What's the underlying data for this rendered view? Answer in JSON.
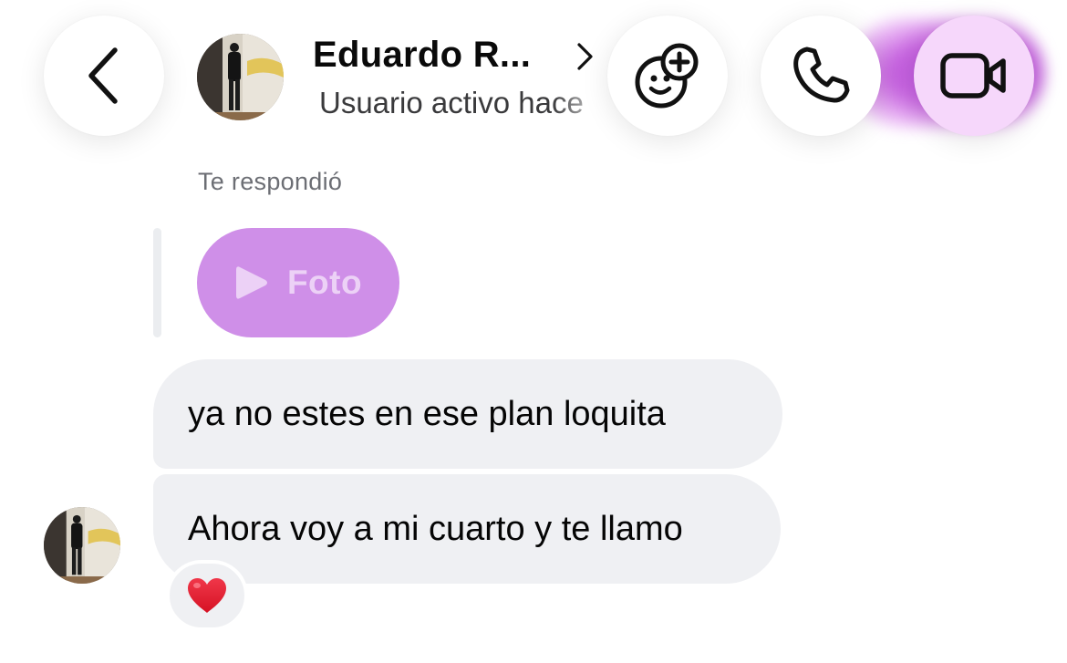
{
  "header": {
    "contact_name": "Eduardo R...",
    "status": "Usuario activo hace",
    "icons": {
      "back": "chevron-left-icon",
      "profile": "chevron-right-icon",
      "effects": "face-plus-icon",
      "call": "phone-icon",
      "video": "video-camera-icon"
    },
    "accent_color": "#b34ad6"
  },
  "conversation": {
    "reply_label": "Te respondió",
    "replied_to": {
      "label": "Foto",
      "icon": "play-icon",
      "color": "#cf8fe8"
    },
    "messages": [
      {
        "text": "ya no estes en ese plan loquita"
      },
      {
        "text": "Ahora voy a mi cuarto y te llamo",
        "reaction": "❤️"
      }
    ]
  }
}
